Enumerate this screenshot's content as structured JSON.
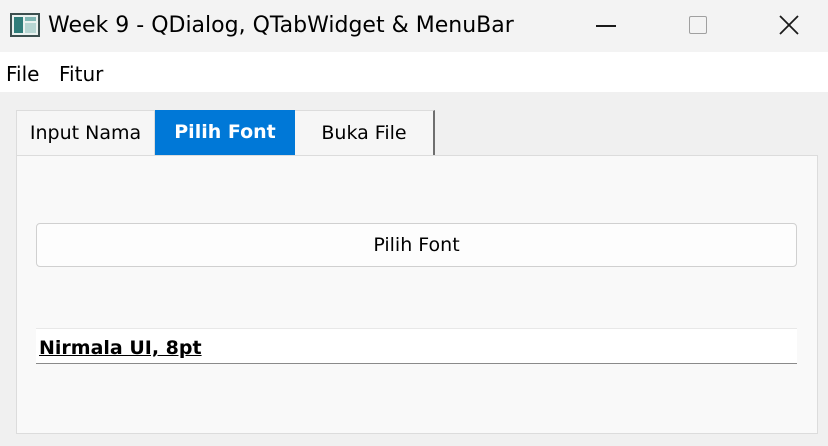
{
  "window": {
    "title": "Week 9 - QDialog, QTabWidget & MenuBar",
    "icon": "app-window-icon",
    "controls": [
      "minimize-icon",
      "maximize-icon",
      "close-icon"
    ]
  },
  "menubar": {
    "items": [
      {
        "label": "File"
      },
      {
        "label": "Fitur"
      }
    ]
  },
  "tabs": {
    "items": [
      {
        "label": "Input Nama",
        "selected": false
      },
      {
        "label": "Pilih Font",
        "selected": true
      },
      {
        "label": "Buka File",
        "selected": false
      }
    ],
    "accent": "#0078d7"
  },
  "pane": {
    "button_label": "Pilih Font",
    "font_label": "Nirmala UI, 8pt"
  }
}
